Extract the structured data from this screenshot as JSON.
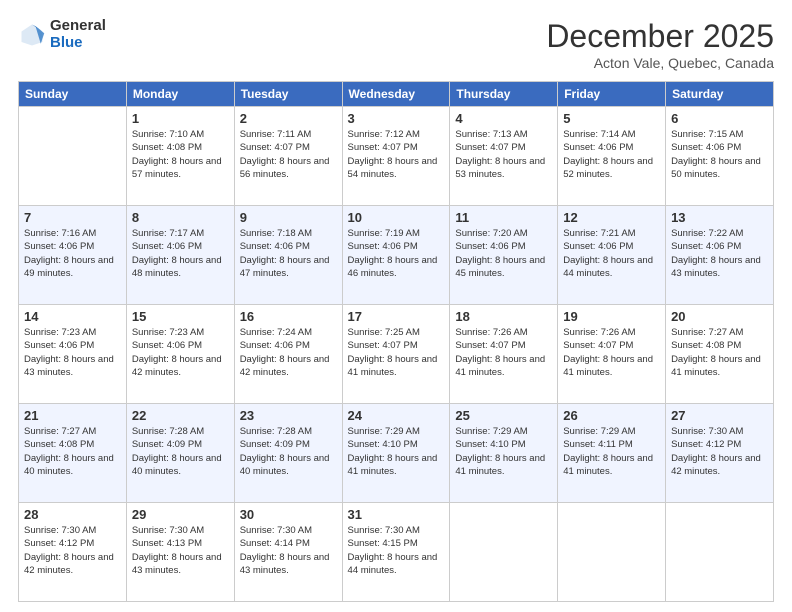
{
  "header": {
    "logo_general": "General",
    "logo_blue": "Blue",
    "month_title": "December 2025",
    "subtitle": "Acton Vale, Quebec, Canada"
  },
  "days_of_week": [
    "Sunday",
    "Monday",
    "Tuesday",
    "Wednesday",
    "Thursday",
    "Friday",
    "Saturday"
  ],
  "weeks": [
    [
      {
        "day": "",
        "sunrise": "",
        "sunset": "",
        "daylight": ""
      },
      {
        "day": "1",
        "sunrise": "Sunrise: 7:10 AM",
        "sunset": "Sunset: 4:08 PM",
        "daylight": "Daylight: 8 hours and 57 minutes."
      },
      {
        "day": "2",
        "sunrise": "Sunrise: 7:11 AM",
        "sunset": "Sunset: 4:07 PM",
        "daylight": "Daylight: 8 hours and 56 minutes."
      },
      {
        "day": "3",
        "sunrise": "Sunrise: 7:12 AM",
        "sunset": "Sunset: 4:07 PM",
        "daylight": "Daylight: 8 hours and 54 minutes."
      },
      {
        "day": "4",
        "sunrise": "Sunrise: 7:13 AM",
        "sunset": "Sunset: 4:07 PM",
        "daylight": "Daylight: 8 hours and 53 minutes."
      },
      {
        "day": "5",
        "sunrise": "Sunrise: 7:14 AM",
        "sunset": "Sunset: 4:06 PM",
        "daylight": "Daylight: 8 hours and 52 minutes."
      },
      {
        "day": "6",
        "sunrise": "Sunrise: 7:15 AM",
        "sunset": "Sunset: 4:06 PM",
        "daylight": "Daylight: 8 hours and 50 minutes."
      }
    ],
    [
      {
        "day": "7",
        "sunrise": "Sunrise: 7:16 AM",
        "sunset": "Sunset: 4:06 PM",
        "daylight": "Daylight: 8 hours and 49 minutes."
      },
      {
        "day": "8",
        "sunrise": "Sunrise: 7:17 AM",
        "sunset": "Sunset: 4:06 PM",
        "daylight": "Daylight: 8 hours and 48 minutes."
      },
      {
        "day": "9",
        "sunrise": "Sunrise: 7:18 AM",
        "sunset": "Sunset: 4:06 PM",
        "daylight": "Daylight: 8 hours and 47 minutes."
      },
      {
        "day": "10",
        "sunrise": "Sunrise: 7:19 AM",
        "sunset": "Sunset: 4:06 PM",
        "daylight": "Daylight: 8 hours and 46 minutes."
      },
      {
        "day": "11",
        "sunrise": "Sunrise: 7:20 AM",
        "sunset": "Sunset: 4:06 PM",
        "daylight": "Daylight: 8 hours and 45 minutes."
      },
      {
        "day": "12",
        "sunrise": "Sunrise: 7:21 AM",
        "sunset": "Sunset: 4:06 PM",
        "daylight": "Daylight: 8 hours and 44 minutes."
      },
      {
        "day": "13",
        "sunrise": "Sunrise: 7:22 AM",
        "sunset": "Sunset: 4:06 PM",
        "daylight": "Daylight: 8 hours and 43 minutes."
      }
    ],
    [
      {
        "day": "14",
        "sunrise": "Sunrise: 7:23 AM",
        "sunset": "Sunset: 4:06 PM",
        "daylight": "Daylight: 8 hours and 43 minutes."
      },
      {
        "day": "15",
        "sunrise": "Sunrise: 7:23 AM",
        "sunset": "Sunset: 4:06 PM",
        "daylight": "Daylight: 8 hours and 42 minutes."
      },
      {
        "day": "16",
        "sunrise": "Sunrise: 7:24 AM",
        "sunset": "Sunset: 4:06 PM",
        "daylight": "Daylight: 8 hours and 42 minutes."
      },
      {
        "day": "17",
        "sunrise": "Sunrise: 7:25 AM",
        "sunset": "Sunset: 4:07 PM",
        "daylight": "Daylight: 8 hours and 41 minutes."
      },
      {
        "day": "18",
        "sunrise": "Sunrise: 7:26 AM",
        "sunset": "Sunset: 4:07 PM",
        "daylight": "Daylight: 8 hours and 41 minutes."
      },
      {
        "day": "19",
        "sunrise": "Sunrise: 7:26 AM",
        "sunset": "Sunset: 4:07 PM",
        "daylight": "Daylight: 8 hours and 41 minutes."
      },
      {
        "day": "20",
        "sunrise": "Sunrise: 7:27 AM",
        "sunset": "Sunset: 4:08 PM",
        "daylight": "Daylight: 8 hours and 41 minutes."
      }
    ],
    [
      {
        "day": "21",
        "sunrise": "Sunrise: 7:27 AM",
        "sunset": "Sunset: 4:08 PM",
        "daylight": "Daylight: 8 hours and 40 minutes."
      },
      {
        "day": "22",
        "sunrise": "Sunrise: 7:28 AM",
        "sunset": "Sunset: 4:09 PM",
        "daylight": "Daylight: 8 hours and 40 minutes."
      },
      {
        "day": "23",
        "sunrise": "Sunrise: 7:28 AM",
        "sunset": "Sunset: 4:09 PM",
        "daylight": "Daylight: 8 hours and 40 minutes."
      },
      {
        "day": "24",
        "sunrise": "Sunrise: 7:29 AM",
        "sunset": "Sunset: 4:10 PM",
        "daylight": "Daylight: 8 hours and 41 minutes."
      },
      {
        "day": "25",
        "sunrise": "Sunrise: 7:29 AM",
        "sunset": "Sunset: 4:10 PM",
        "daylight": "Daylight: 8 hours and 41 minutes."
      },
      {
        "day": "26",
        "sunrise": "Sunrise: 7:29 AM",
        "sunset": "Sunset: 4:11 PM",
        "daylight": "Daylight: 8 hours and 41 minutes."
      },
      {
        "day": "27",
        "sunrise": "Sunrise: 7:30 AM",
        "sunset": "Sunset: 4:12 PM",
        "daylight": "Daylight: 8 hours and 42 minutes."
      }
    ],
    [
      {
        "day": "28",
        "sunrise": "Sunrise: 7:30 AM",
        "sunset": "Sunset: 4:12 PM",
        "daylight": "Daylight: 8 hours and 42 minutes."
      },
      {
        "day": "29",
        "sunrise": "Sunrise: 7:30 AM",
        "sunset": "Sunset: 4:13 PM",
        "daylight": "Daylight: 8 hours and 43 minutes."
      },
      {
        "day": "30",
        "sunrise": "Sunrise: 7:30 AM",
        "sunset": "Sunset: 4:14 PM",
        "daylight": "Daylight: 8 hours and 43 minutes."
      },
      {
        "day": "31",
        "sunrise": "Sunrise: 7:30 AM",
        "sunset": "Sunset: 4:15 PM",
        "daylight": "Daylight: 8 hours and 44 minutes."
      },
      {
        "day": "",
        "sunrise": "",
        "sunset": "",
        "daylight": ""
      },
      {
        "day": "",
        "sunrise": "",
        "sunset": "",
        "daylight": ""
      },
      {
        "day": "",
        "sunrise": "",
        "sunset": "",
        "daylight": ""
      }
    ]
  ]
}
